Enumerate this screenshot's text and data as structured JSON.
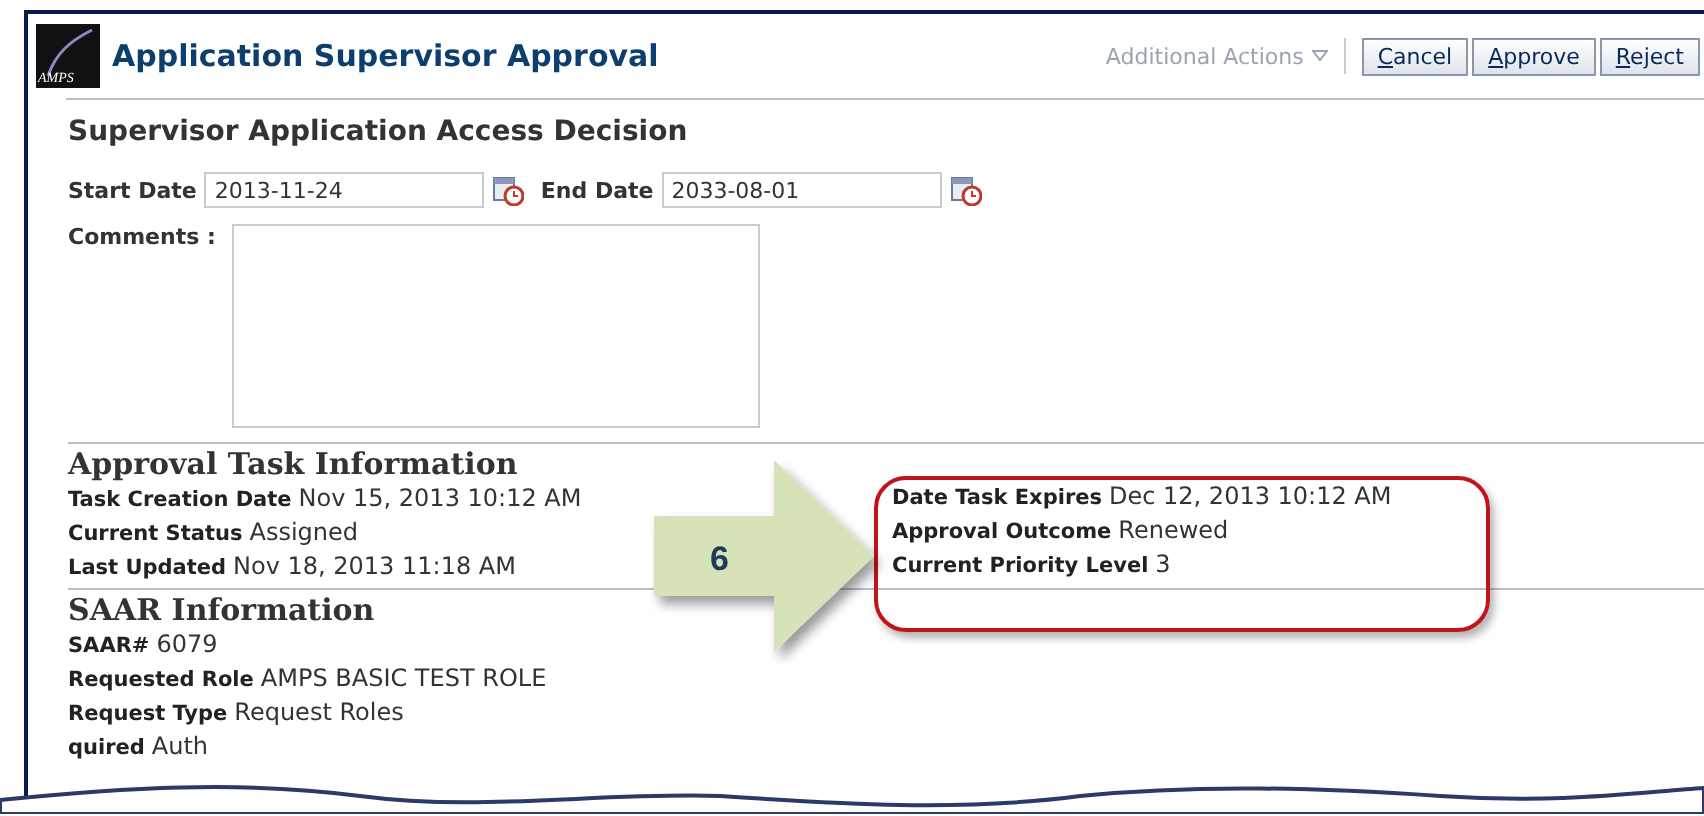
{
  "header": {
    "title": "Application Supervisor Approval",
    "logo_text": "AMPS",
    "additional_actions": "Additional Actions",
    "buttons": [
      {
        "access_key": "C",
        "rest": "ancel"
      },
      {
        "access_key": "A",
        "rest": "pprove"
      },
      {
        "access_key": "R",
        "rest": "eject"
      }
    ]
  },
  "decision": {
    "title": "Supervisor Application Access Decision",
    "start_date": {
      "label": "Start Date",
      "value": "2013-11-24"
    },
    "end_date": {
      "label": "End Date",
      "value": "2033-08-01"
    },
    "comments_label": "Comments :"
  },
  "task_info": {
    "title": "Approval Task Information",
    "left": [
      {
        "label": "Task Creation Date",
        "value": "Nov 15, 2013 10:12 AM"
      },
      {
        "label": "Current Status",
        "value": "Assigned"
      },
      {
        "label": "Last Updated",
        "value": "Nov 18, 2013 11:18 AM"
      }
    ],
    "right": [
      {
        "label": "Date Task Expires",
        "value": "Dec 12, 2013 10:12 AM"
      },
      {
        "label": "Approval Outcome",
        "value": "Renewed"
      },
      {
        "label": "Current Priority Level",
        "value": "3"
      }
    ]
  },
  "saar": {
    "title": "SAAR Information",
    "rows": [
      {
        "label": "SAAR#",
        "value": "6079"
      },
      {
        "label": "Requested Role",
        "value": "AMPS BASIC TEST ROLE"
      },
      {
        "label": "Request Type",
        "value": "Request Roles"
      },
      {
        "label": "quired",
        "value": "Auth"
      }
    ]
  },
  "callout": {
    "number": "6"
  }
}
